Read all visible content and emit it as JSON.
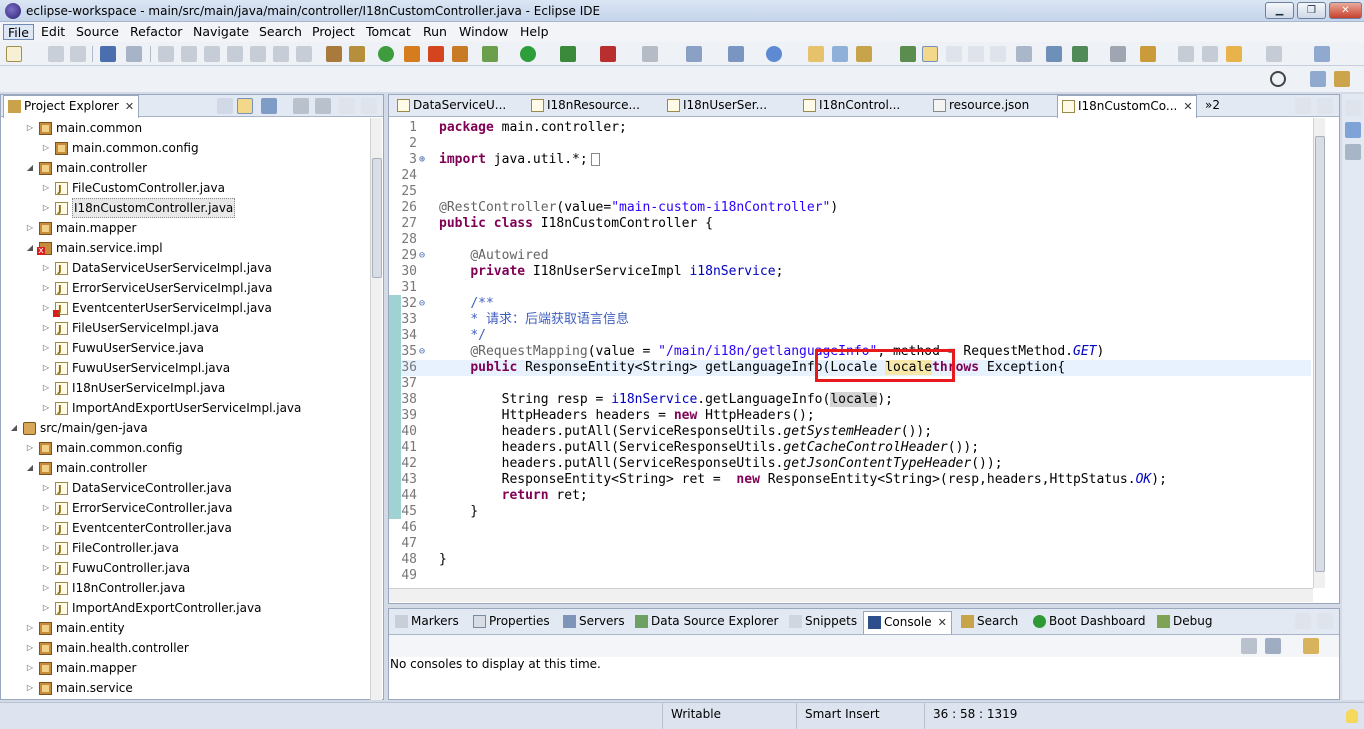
{
  "window": {
    "title": "eclipse-workspace - main/src/main/java/main/controller/I18nCustomController.java - Eclipse IDE",
    "minimize_label": "▁",
    "maximize_label": "❐",
    "close_label": "✕"
  },
  "menubar": {
    "items": [
      "File",
      "Edit",
      "Source",
      "Refactor",
      "Navigate",
      "Search",
      "Project",
      "Tomcat",
      "Run",
      "Window",
      "Help"
    ]
  },
  "project_explorer": {
    "tab_label": "Project Explorer",
    "tree": [
      {
        "label": "main.common",
        "icon": "package-icon",
        "expanded": false
      },
      {
        "label": "main.common.config",
        "icon": "package-icon",
        "expanded": false
      },
      {
        "label": "main.controller",
        "icon": "package-icon",
        "expanded": true
      },
      {
        "label": "FileCustomController.java",
        "icon": "java-file-icon",
        "expanded": false
      },
      {
        "label": "I18nCustomController.java",
        "icon": "java-file-icon",
        "expanded": false,
        "selected": true
      },
      {
        "label": "main.mapper",
        "icon": "package-icon",
        "expanded": false
      },
      {
        "label": "main.service.impl",
        "icon": "package-error-icon",
        "expanded": true
      },
      {
        "label": "DataServiceUserServiceImpl.java",
        "icon": "java-file-icon",
        "expanded": false
      },
      {
        "label": "ErrorServiceUserServiceImpl.java",
        "icon": "java-file-icon",
        "expanded": false
      },
      {
        "label": "EventcenterUserServiceImpl.java",
        "icon": "java-file-error-icon",
        "expanded": false
      },
      {
        "label": "FileUserServiceImpl.java",
        "icon": "java-file-icon",
        "expanded": false
      },
      {
        "label": "FuwuUserService.java",
        "icon": "java-file-icon",
        "expanded": false
      },
      {
        "label": "FuwuUserServiceImpl.java",
        "icon": "java-file-icon",
        "expanded": false
      },
      {
        "label": "I18nUserServiceImpl.java",
        "icon": "java-file-icon",
        "expanded": false
      },
      {
        "label": "ImportAndExportUserServiceImpl.java",
        "icon": "java-file-icon",
        "expanded": false
      },
      {
        "label": "src/main/gen-java",
        "icon": "source-folder-icon",
        "expanded": true
      },
      {
        "label": "main.common.config",
        "icon": "package-icon",
        "expanded": false
      },
      {
        "label": "main.controller",
        "icon": "package-icon",
        "expanded": true
      },
      {
        "label": "DataServiceController.java",
        "icon": "java-file-icon",
        "expanded": false
      },
      {
        "label": "ErrorServiceController.java",
        "icon": "java-file-icon",
        "expanded": false
      },
      {
        "label": "EventcenterController.java",
        "icon": "java-file-icon",
        "expanded": false
      },
      {
        "label": "FileController.java",
        "icon": "java-file-icon",
        "expanded": false
      },
      {
        "label": "FuwuController.java",
        "icon": "java-file-icon",
        "expanded": false
      },
      {
        "label": "I18nController.java",
        "icon": "java-file-icon",
        "expanded": false
      },
      {
        "label": "ImportAndExportController.java",
        "icon": "java-file-icon",
        "expanded": false
      },
      {
        "label": "main.entity",
        "icon": "package-icon",
        "expanded": false
      },
      {
        "label": "main.health.controller",
        "icon": "package-icon",
        "expanded": false
      },
      {
        "label": "main.mapper",
        "icon": "package-icon",
        "expanded": false
      },
      {
        "label": "main.service",
        "icon": "package-icon",
        "expanded": false
      }
    ]
  },
  "editor": {
    "tabs": [
      {
        "label": "DataServiceU..."
      },
      {
        "label": "I18nResource..."
      },
      {
        "label": "I18nUserSer..."
      },
      {
        "label": "I18nControl..."
      },
      {
        "label": "resource.json"
      },
      {
        "label": "I18nCustomCo...",
        "active": true
      }
    ],
    "overflow_label": "»2",
    "lines": [
      {
        "n": "1",
        "parts": [
          [
            "kw",
            "package"
          ],
          [
            "",
            "main.controller;"
          ]
        ]
      },
      {
        "n": "2",
        "parts": []
      },
      {
        "n": "3",
        "parts": [
          [
            "kw",
            "import"
          ],
          [
            "",
            " java.util.*;"
          ]
        ],
        "folded": true
      },
      {
        "n": "24",
        "parts": []
      },
      {
        "n": "25",
        "parts": []
      },
      {
        "n": "26",
        "parts": [
          [
            "ann",
            "@RestController"
          ],
          [
            "",
            "(value="
          ],
          [
            "str",
            "\"main-custom-i18nController\""
          ],
          [
            "",
            ")"
          ]
        ]
      },
      {
        "n": "27",
        "parts": [
          [
            "kw",
            "public class"
          ],
          [
            "",
            " I18nCustomController {"
          ]
        ]
      },
      {
        "n": "28",
        "parts": []
      },
      {
        "n": "29",
        "parts": [
          [
            "",
            "    "
          ],
          [
            "ann",
            "@Autowired"
          ]
        ],
        "fold": true
      },
      {
        "n": "30",
        "parts": [
          [
            "",
            "    "
          ],
          [
            "kw",
            "private"
          ],
          [
            "",
            " I18nUserServiceImpl "
          ],
          [
            "fld",
            "i18nService"
          ],
          [
            "",
            ";"
          ]
        ]
      },
      {
        "n": "31",
        "parts": []
      },
      {
        "n": "32",
        "parts": [
          [
            "",
            "    "
          ],
          [
            "cm",
            "/**"
          ]
        ],
        "fold": true
      },
      {
        "n": "33",
        "parts": [
          [
            "",
            "    "
          ],
          [
            "cm",
            "* 请求：后端获取语言信息"
          ]
        ]
      },
      {
        "n": "34",
        "parts": [
          [
            "",
            "    "
          ],
          [
            "cm",
            "*/"
          ]
        ]
      },
      {
        "n": "35",
        "parts": [
          [
            "",
            "    "
          ],
          [
            "ann",
            "@RequestMapping"
          ],
          [
            "",
            "(value = "
          ],
          [
            "str",
            "\"/main/i18n/getlanguageInfo\""
          ],
          [
            "",
            ", method = RequestMethod."
          ],
          [
            "stat",
            "GET"
          ],
          [
            "",
            ")"
          ]
        ],
        "fold": true
      },
      {
        "n": "36",
        "parts": [
          [
            "",
            "    "
          ],
          [
            "kw",
            "public"
          ],
          [
            "",
            " ResponseEntity<String> getLanguageInfo(Locale "
          ],
          [
            "occ2",
            "locale"
          ],
          [
            ") "
          ],
          [
            "kw",
            "throws"
          ],
          [
            "",
            " Exception{"
          ]
        ],
        "current": true
      },
      {
        "n": "37",
        "parts": []
      },
      {
        "n": "38",
        "parts": [
          [
            "",
            "        String resp = "
          ],
          [
            "fld",
            "i18nService"
          ],
          [
            "",
            ".getLanguageInfo("
          ],
          [
            "occ",
            "locale"
          ],
          [
            "",
            ");"
          ]
        ]
      },
      {
        "n": "39",
        "parts": [
          [
            "",
            "        HttpHeaders headers = "
          ],
          [
            "kw",
            "new"
          ],
          [
            "",
            " HttpHeaders();"
          ]
        ]
      },
      {
        "n": "40",
        "parts": [
          [
            "",
            "        headers.putAll(ServiceResponseUtils."
          ],
          [
            "statm",
            "getSystemHeader"
          ],
          [
            "",
            "());"
          ]
        ]
      },
      {
        "n": "41",
        "parts": [
          [
            "",
            "        headers.putAll(ServiceResponseUtils."
          ],
          [
            "statm",
            "getCacheControlHeader"
          ],
          [
            "",
            "());"
          ]
        ]
      },
      {
        "n": "42",
        "parts": [
          [
            "",
            "        headers.putAll(ServiceResponseUtils."
          ],
          [
            "statm",
            "getJsonContentTypeHeader"
          ],
          [
            "",
            "());"
          ]
        ]
      },
      {
        "n": "43",
        "parts": [
          [
            "",
            "        ResponseEntity<String> ret =  "
          ],
          [
            "kw",
            "new"
          ],
          [
            "",
            " ResponseEntity<String>(resp,headers,HttpStatus."
          ],
          [
            "stat",
            "OK"
          ],
          [
            "",
            ");"
          ]
        ]
      },
      {
        "n": "44",
        "parts": [
          [
            "",
            "        "
          ],
          [
            "kw",
            "return"
          ],
          [
            "",
            " ret;"
          ]
        ]
      },
      {
        "n": "45",
        "parts": [
          [
            "",
            "    }"
          ]
        ]
      },
      {
        "n": "46",
        "parts": []
      },
      {
        "n": "47",
        "parts": []
      },
      {
        "n": "48",
        "parts": [
          [
            "",
            "}"
          ]
        ]
      },
      {
        "n": "49",
        "parts": []
      }
    ]
  },
  "bottom_panel": {
    "tabs": [
      {
        "label": "Markers"
      },
      {
        "label": "Properties"
      },
      {
        "label": "Servers"
      },
      {
        "label": "Data Source Explorer"
      },
      {
        "label": "Snippets"
      },
      {
        "label": "Console",
        "active": true
      },
      {
        "label": "Search"
      },
      {
        "label": "Boot Dashboard"
      },
      {
        "label": "Debug"
      }
    ],
    "message": "No consoles to display at this time."
  },
  "status": {
    "writable": "Writable",
    "insert_mode": "Smart Insert",
    "position": "36 : 58 : 1319"
  },
  "colors": {
    "keyword": "#7f0055",
    "string": "#2a00ff",
    "annotation": "#646464",
    "comment": "#3f5fbf",
    "highlight_box": "#e8191c"
  }
}
